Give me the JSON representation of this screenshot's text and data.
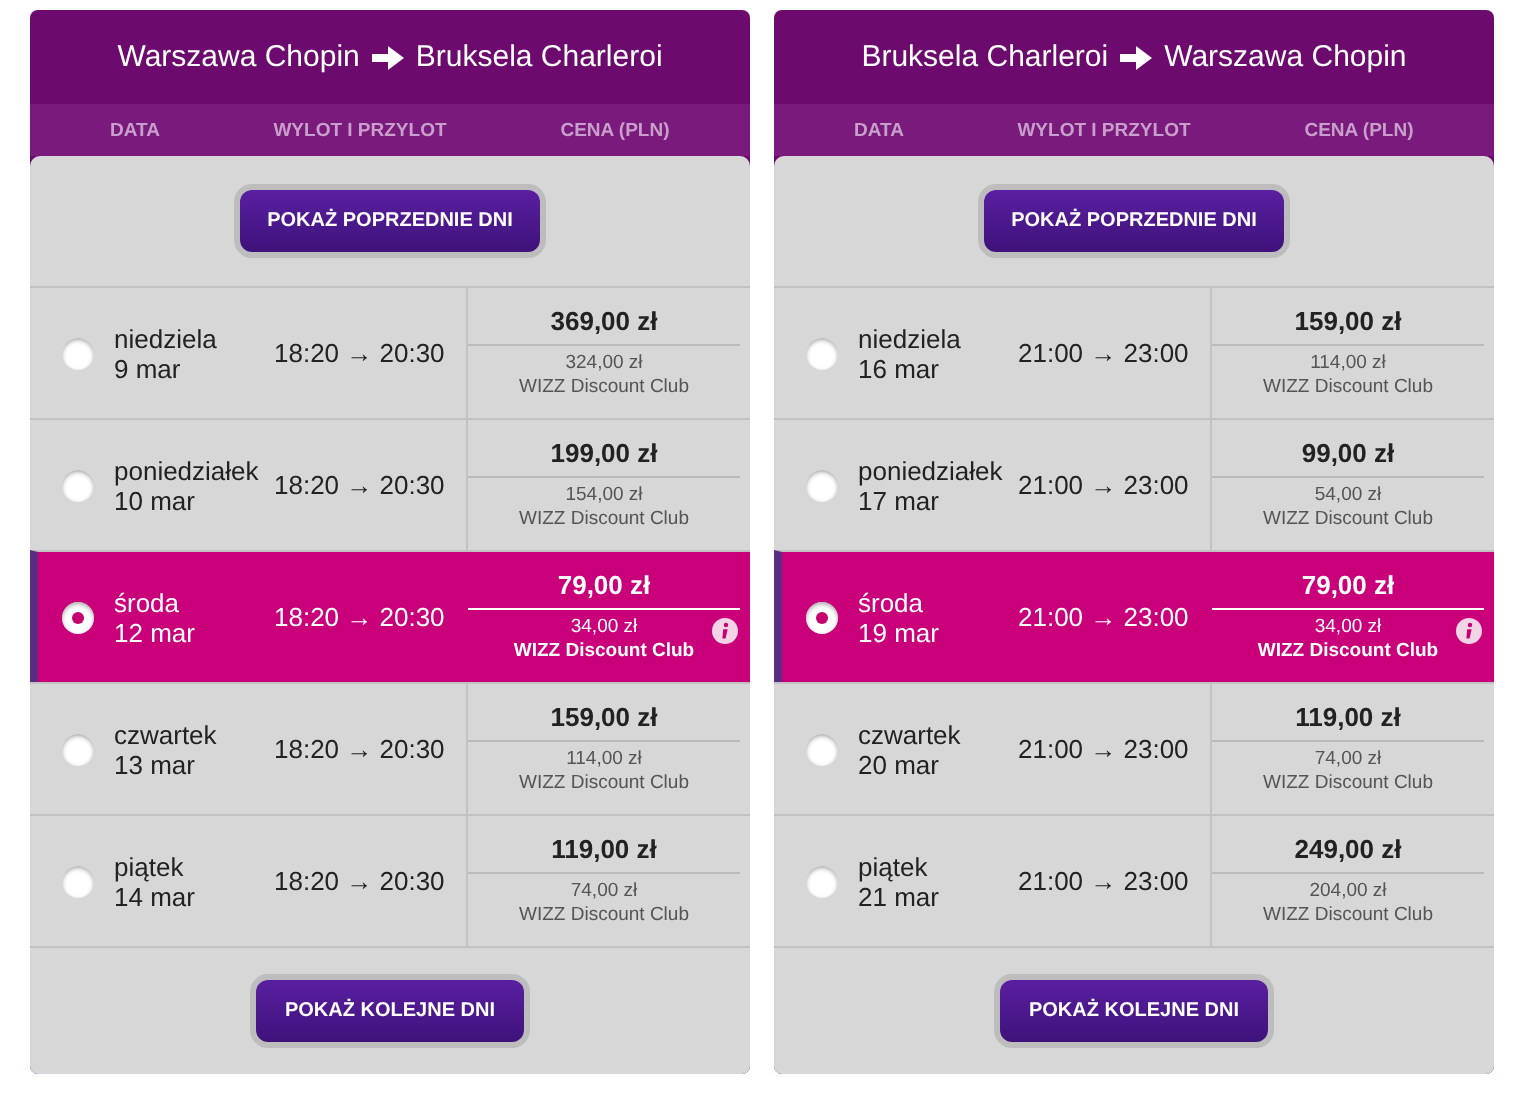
{
  "panels": [
    {
      "from": "Warszawa Chopin",
      "to": "Bruksela Charleroi",
      "columns": [
        "DATA",
        "WYLOT I PRZYLOT",
        "CENA (PLN)"
      ],
      "prev_button": "POKAŻ POPRZEDNIE DNI",
      "next_button": "POKAŻ KOLEJNE DNI",
      "rows": [
        {
          "day": "niedziela",
          "date": "9 mar",
          "times": "18:20 → 20:30",
          "price": "369,00 zł",
          "club_price": "324,00 zł",
          "club": "WIZZ Discount Club",
          "selected": false
        },
        {
          "day": "poniedziałek",
          "date": "10 mar",
          "times": "18:20 → 20:30",
          "price": "199,00 zł",
          "club_price": "154,00 zł",
          "club": "WIZZ Discount Club",
          "selected": false
        },
        {
          "day": "środa",
          "date": "12 mar",
          "times": "18:20 → 20:30",
          "price": "79,00 zł",
          "club_price": "34,00 zł",
          "club": "WIZZ Discount Club",
          "selected": true
        },
        {
          "day": "czwartek",
          "date": "13 mar",
          "times": "18:20 → 20:30",
          "price": "159,00 zł",
          "club_price": "114,00 zł",
          "club": "WIZZ Discount Club",
          "selected": false
        },
        {
          "day": "piątek",
          "date": "14 mar",
          "times": "18:20 → 20:30",
          "price": "119,00 zł",
          "club_price": "74,00 zł",
          "club": "WIZZ Discount Club",
          "selected": false
        }
      ]
    },
    {
      "from": "Bruksela Charleroi",
      "to": "Warszawa Chopin",
      "columns": [
        "DATA",
        "WYLOT I PRZYLOT",
        "CENA (PLN)"
      ],
      "prev_button": "POKAŻ POPRZEDNIE DNI",
      "next_button": "POKAŻ KOLEJNE DNI",
      "rows": [
        {
          "day": "niedziela",
          "date": "16 mar",
          "times": "21:00 → 23:00",
          "price": "159,00 zł",
          "club_price": "114,00 zł",
          "club": "WIZZ Discount Club",
          "selected": false
        },
        {
          "day": "poniedziałek",
          "date": "17 mar",
          "times": "21:00 → 23:00",
          "price": "99,00 zł",
          "club_price": "54,00 zł",
          "club": "WIZZ Discount Club",
          "selected": false
        },
        {
          "day": "środa",
          "date": "19 mar",
          "times": "21:00 → 23:00",
          "price": "79,00 zł",
          "club_price": "34,00 zł",
          "club": "WIZZ Discount Club",
          "selected": true
        },
        {
          "day": "czwartek",
          "date": "20 mar",
          "times": "21:00 → 23:00",
          "price": "119,00 zł",
          "club_price": "74,00 zł",
          "club": "WIZZ Discount Club",
          "selected": false
        },
        {
          "day": "piątek",
          "date": "21 mar",
          "times": "21:00 → 23:00",
          "price": "249,00 zł",
          "club_price": "204,00 zł",
          "club": "WIZZ Discount Club",
          "selected": false
        }
      ]
    }
  ]
}
